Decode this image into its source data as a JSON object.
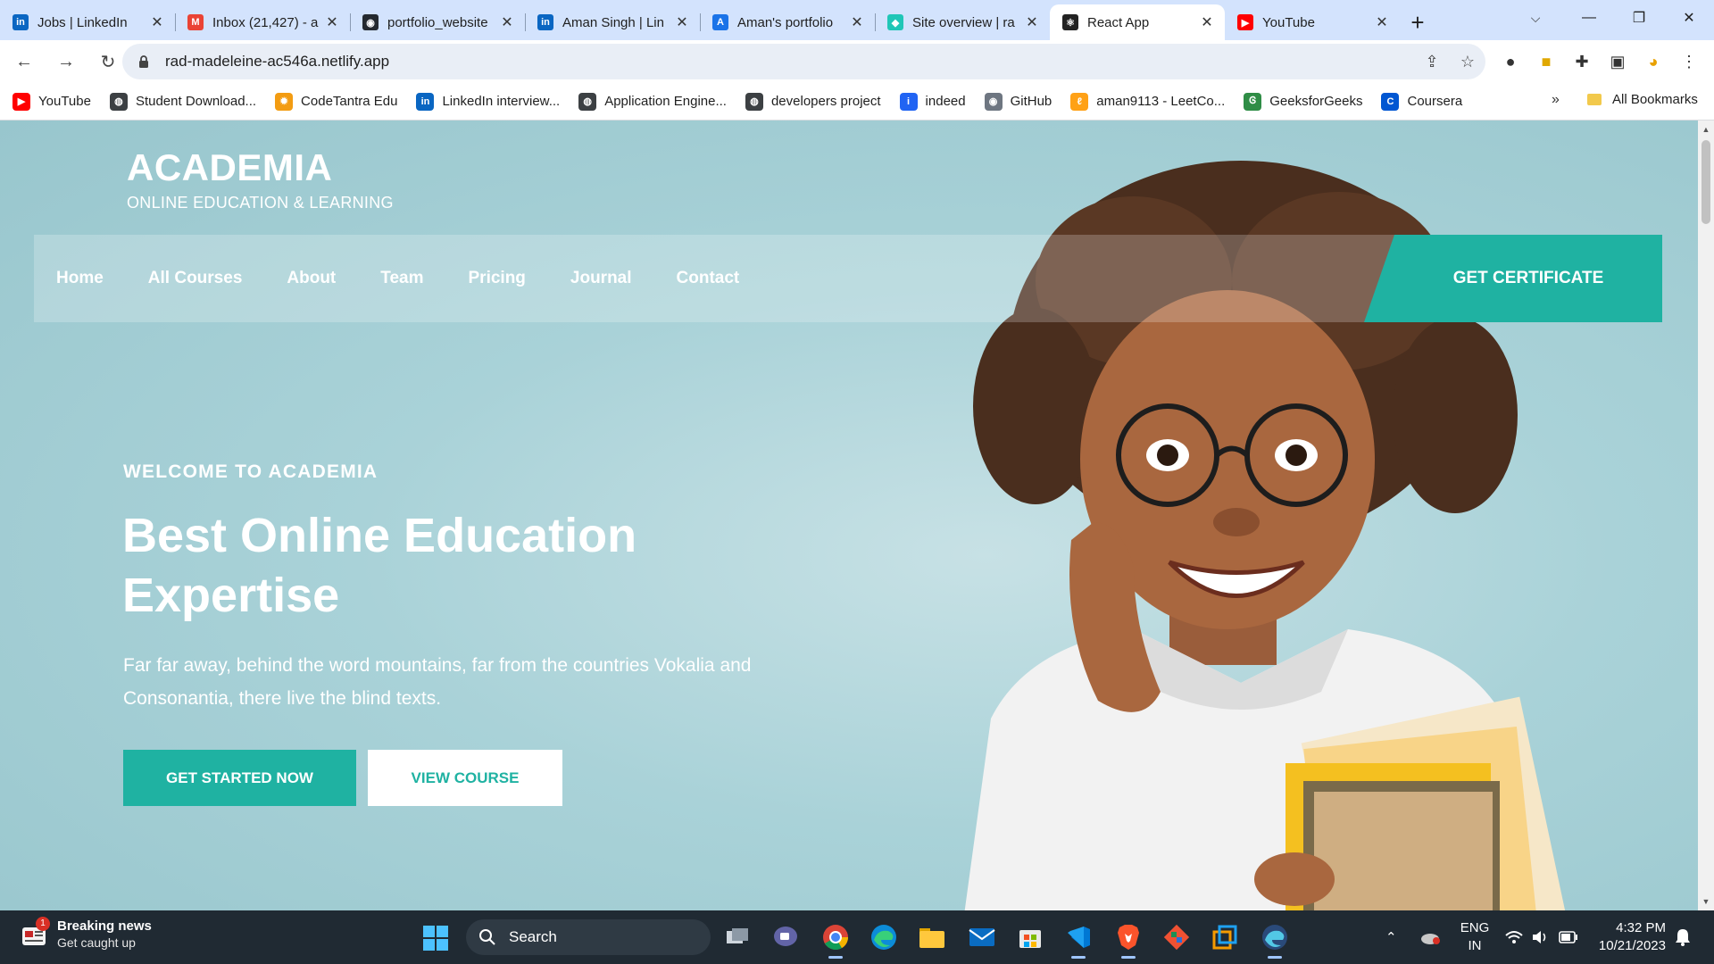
{
  "browser": {
    "tabs": [
      {
        "title": "Jobs | LinkedIn",
        "icon": "linkedin-icon",
        "color": "#0a66c2",
        "glyph": "in"
      },
      {
        "title": "Inbox (21,427) - a",
        "icon": "gmail-icon",
        "color": "#ea4335",
        "glyph": "M"
      },
      {
        "title": "portfolio_website",
        "icon": "github-icon",
        "color": "#24292f",
        "glyph": "◉"
      },
      {
        "title": "Aman Singh | Lin",
        "icon": "linkedin-icon",
        "color": "#0a66c2",
        "glyph": "in"
      },
      {
        "title": "Aman's portfolio",
        "icon": "portfolio-a-icon",
        "color": "#1a73e8",
        "glyph": "A"
      },
      {
        "title": "Site overview | ra",
        "icon": "netlify-icon",
        "color": "#20c6b7",
        "glyph": "◆"
      },
      {
        "title": "React App",
        "icon": "react-icon",
        "color": "#222222",
        "glyph": "⚛"
      },
      {
        "title": "YouTube",
        "icon": "youtube-icon",
        "color": "#ff0000",
        "glyph": "▶"
      }
    ],
    "active_tab_index": 6,
    "url": "rad-madeleine-ac546a.netlify.app",
    "bookmarks": [
      {
        "label": "YouTube",
        "icon": "youtube-icon",
        "color": "#ff0000",
        "glyph": "▶"
      },
      {
        "label": "Student Download...",
        "icon": "globe-icon",
        "color": "#3c4043",
        "glyph": "◍"
      },
      {
        "label": "CodeTantra Edu",
        "icon": "codetantra-icon",
        "color": "#f39c12",
        "glyph": "✹"
      },
      {
        "label": "LinkedIn interview...",
        "icon": "linkedin-icon",
        "color": "#0a66c2",
        "glyph": "in"
      },
      {
        "label": "Application Engine...",
        "icon": "globe-icon",
        "color": "#3c4043",
        "glyph": "◍"
      },
      {
        "label": "developers project",
        "icon": "globe-icon",
        "color": "#3c4043",
        "glyph": "◍"
      },
      {
        "label": "indeed",
        "icon": "indeed-icon",
        "color": "#2164f3",
        "glyph": "i"
      },
      {
        "label": "GitHub",
        "icon": "github-icon",
        "color": "#6e7681",
        "glyph": "◉"
      },
      {
        "label": "aman9113 - LeetCo...",
        "icon": "leetcode-icon",
        "color": "#ffa116",
        "glyph": "ℓ"
      },
      {
        "label": "GeeksforGeeks",
        "icon": "geeksforgeeks-icon",
        "color": "#2f8d46",
        "glyph": "Ꮆ"
      },
      {
        "label": "Coursera",
        "icon": "coursera-icon",
        "color": "#0056d2",
        "glyph": "C"
      }
    ],
    "all_bookmarks_label": "All Bookmarks",
    "more_glyph": "»"
  },
  "site": {
    "brand_name": "ACADEMIA",
    "brand_tagline": "ONLINE EDUCATION & LEARNING",
    "nav": [
      "Home",
      "All Courses",
      "About",
      "Team",
      "Pricing",
      "Journal",
      "Contact"
    ],
    "cta_label": "GET CERTIFICATE",
    "hero": {
      "eyebrow": "WELCOME TO ACADEMIA",
      "title": "Best Online Education Expertise",
      "text": "Far far away, behind the word mountains, far from the countries Vokalia and Consonantia, there live the blind texts.",
      "primary_label": "GET STARTED NOW",
      "secondary_label": "VIEW COURSE"
    },
    "accent": "#1fb2a2"
  },
  "taskbar": {
    "news_title": "Breaking news",
    "news_subtitle": "Get caught up",
    "news_badge": "1",
    "search_label": "Search",
    "lang_line1": "ENG",
    "lang_line2": "IN",
    "time": "4:32 PM",
    "date": "10/21/2023"
  }
}
